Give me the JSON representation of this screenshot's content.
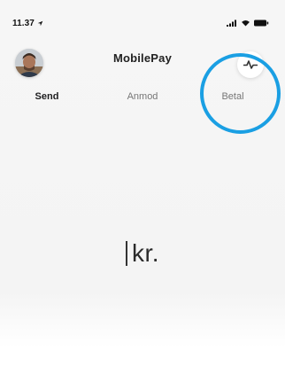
{
  "status_bar": {
    "time": "11.37",
    "location_icon": "location-arrow-icon",
    "signal_icon": "cellular-signal-icon",
    "wifi_icon": "wifi-icon",
    "battery_icon": "battery-icon"
  },
  "header": {
    "title": "MobilePay",
    "avatar_icon": "user-avatar",
    "activity_icon": "activity-pulse-icon"
  },
  "tabs": [
    {
      "label": "Send",
      "active": true
    },
    {
      "label": "Anmod",
      "active": false
    },
    {
      "label": "Betal",
      "active": false
    }
  ],
  "amount": {
    "currency": "kr."
  },
  "colors": {
    "highlight_ring": "#1a9fe3",
    "background": "#f6f6f6"
  }
}
